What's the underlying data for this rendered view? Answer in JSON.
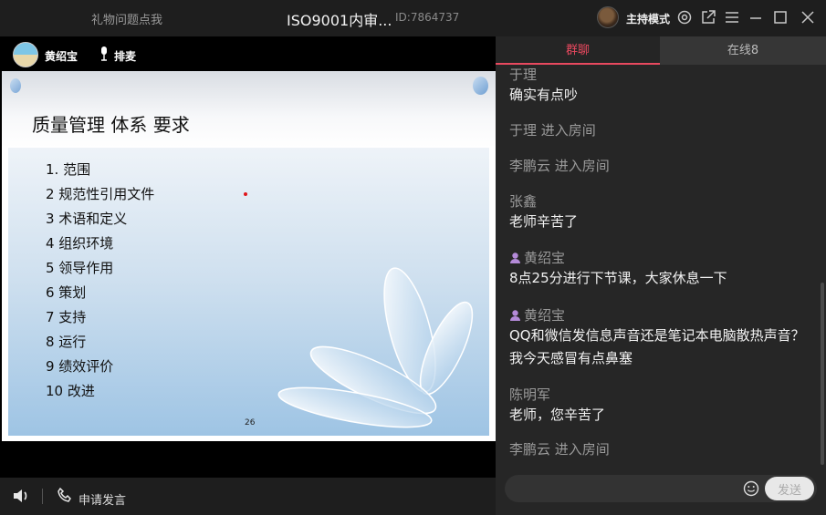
{
  "titlebar": {
    "left_text": "礼物问题点我",
    "title": "ISO9001内审...",
    "room_id": "ID:7864737",
    "host_mode_label": "主持模式"
  },
  "presenter": {
    "name": "黄绍宝",
    "queue_label": "排麦"
  },
  "slide": {
    "title": "质量管理 体系 要求",
    "items": [
      "1.  范围",
      "2  规范性引用文件",
      "3  术语和定义",
      "4  组织环境",
      "5  领导作用",
      "6  策划",
      "7  支持",
      "8  运行",
      "9  绩效评价",
      "10 改进"
    ],
    "page_number": "26"
  },
  "controls": {
    "request_speak_label": "申请发言"
  },
  "tabs": {
    "chat": "群聊",
    "online": "在线8"
  },
  "messages": [
    {
      "type": "user",
      "name": "于理",
      "text": "确实有点吵",
      "host": false
    },
    {
      "type": "system",
      "text": "于理 进入房间"
    },
    {
      "type": "system",
      "text": "李鹏云 进入房间"
    },
    {
      "type": "user",
      "name": "张鑫",
      "text": "老师辛苦了",
      "host": false
    },
    {
      "type": "user",
      "name": "黄绍宝",
      "text": "8点25分进行下节课，大家休息一下",
      "host": true
    },
    {
      "type": "user",
      "name": "黄绍宝",
      "text": "QQ和微信发信息声音还是笔记本电脑散热声音？我今天感冒有点鼻塞",
      "host": true
    },
    {
      "type": "user",
      "name": "陈明军",
      "text": "老师，您辛苦了",
      "host": false
    },
    {
      "type": "system",
      "text": "李鹏云 进入房间"
    }
  ],
  "input": {
    "value": "",
    "send_label": "发送"
  },
  "colors": {
    "accent": "#e8495f",
    "background": "#262626"
  }
}
